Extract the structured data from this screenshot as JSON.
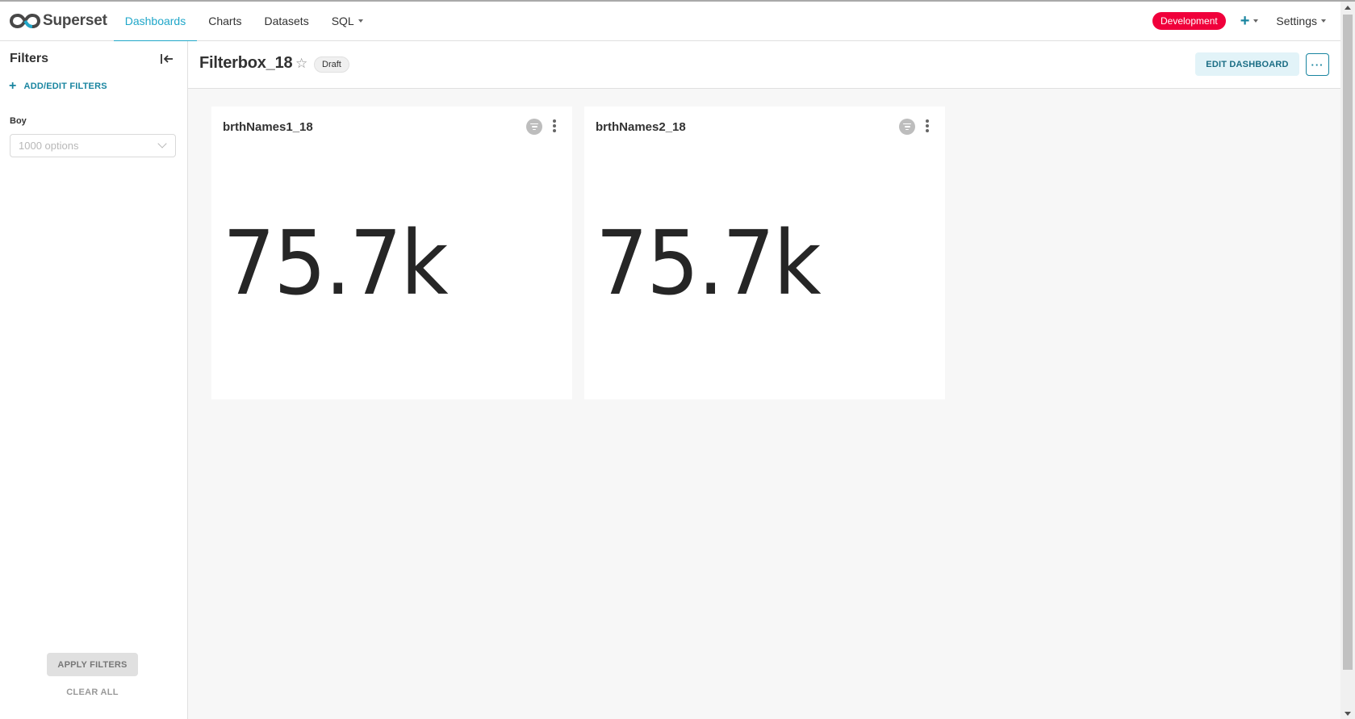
{
  "navbar": {
    "brand": "Superset",
    "items": [
      {
        "label": "Dashboards",
        "active": true
      },
      {
        "label": "Charts",
        "active": false
      },
      {
        "label": "Datasets",
        "active": false
      },
      {
        "label": "SQL",
        "active": false,
        "dropdown": true
      }
    ],
    "env_badge": "Development",
    "new_icon": "plus-icon",
    "settings_label": "Settings"
  },
  "sidebar": {
    "title": "Filters",
    "add_label": "ADD/EDIT FILTERS",
    "filter": {
      "label": "Boy",
      "placeholder": "1000 options"
    },
    "apply_label": "APPLY FILTERS",
    "clear_label": "CLEAR ALL"
  },
  "header": {
    "title": "Filterbox_18",
    "status": "Draft",
    "edit_label": "EDIT DASHBOARD",
    "more_label": "···"
  },
  "charts": [
    {
      "title": "brthNames1_18",
      "value": "75.7k"
    },
    {
      "title": "brthNames2_18",
      "value": "75.7k"
    }
  ],
  "colors": {
    "accent": "#20a7c9",
    "primary_dark": "#1985a0",
    "env_badge": "#f0003b"
  }
}
